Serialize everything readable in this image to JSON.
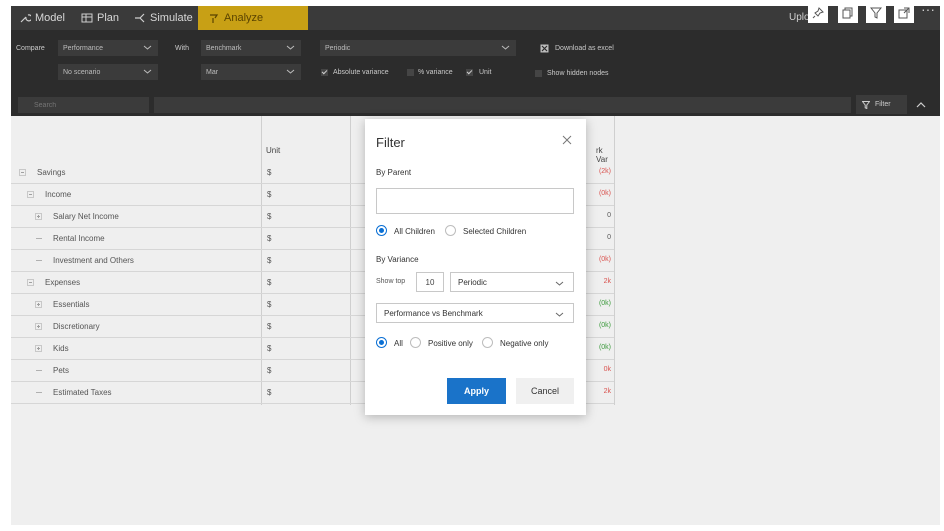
{
  "nav": {
    "tabs": [
      {
        "label": "Model",
        "icon": "wrench-icon"
      },
      {
        "label": "Plan",
        "icon": "table-icon"
      },
      {
        "label": "Simulate",
        "icon": "simulate-icon"
      },
      {
        "label": "Analyze",
        "icon": "analyze-icon"
      }
    ],
    "active_tab": "Analyze",
    "upload_label": "Uploa",
    "active_color": "#c8a015"
  },
  "controls": {
    "compare_label": "Compare",
    "compare_value": "Performance",
    "scenario_value": "No scenario",
    "with_label": "With",
    "with_value": "Benchmark",
    "month_value": "Mar",
    "period_value": "Periodic",
    "abs_variance_label": "Absolute variance",
    "abs_variance_checked": true,
    "pct_variance_label": "% variance",
    "pct_variance_checked": false,
    "unit_label": "Unit",
    "unit_checked": true,
    "download_label": "Download as excel",
    "hidden_nodes_label": "Show hidden nodes",
    "hidden_nodes_checked": false
  },
  "search": {
    "placeholder": "Search",
    "filter_label": "Filter"
  },
  "grid": {
    "unit_header": "Unit",
    "variance_header": "rk Var",
    "rows": [
      {
        "label": "Savings",
        "unit": "$",
        "value": "(2k)",
        "tone": "negative",
        "indent": 0,
        "marker": "minus"
      },
      {
        "label": "Income",
        "unit": "$",
        "value": "(0k)",
        "tone": "negative",
        "indent": 1,
        "marker": "minus"
      },
      {
        "label": "Salary Net Income",
        "unit": "$",
        "value": "0",
        "tone": "neutral",
        "indent": 2,
        "marker": "plus"
      },
      {
        "label": "Rental Income",
        "unit": "$",
        "value": "0",
        "tone": "neutral",
        "indent": 2,
        "marker": "dash"
      },
      {
        "label": "Investment and Others",
        "unit": "$",
        "value": "(0k)",
        "tone": "negative",
        "indent": 2,
        "marker": "dash"
      },
      {
        "label": "Expenses",
        "unit": "$",
        "value": "2k",
        "tone": "negative",
        "indent": 1,
        "marker": "minus"
      },
      {
        "label": "Essentials",
        "unit": "$",
        "value": "(0k)",
        "tone": "positive",
        "indent": 2,
        "marker": "plus"
      },
      {
        "label": "Discretionary",
        "unit": "$",
        "value": "(0k)",
        "tone": "positive",
        "indent": 2,
        "marker": "plus"
      },
      {
        "label": "Kids",
        "unit": "$",
        "value": "(0k)",
        "tone": "positive",
        "indent": 2,
        "marker": "plus"
      },
      {
        "label": "Pets",
        "unit": "$",
        "value": "0k",
        "tone": "negative",
        "indent": 2,
        "marker": "dash"
      },
      {
        "label": "Estimated Taxes",
        "unit": "$",
        "value": "2k",
        "tone": "negative",
        "indent": 2,
        "marker": "dash"
      }
    ],
    "colors": {
      "negative": "#d9534f",
      "positive": "#3c9a3c",
      "neutral": "#555555"
    }
  },
  "filter_dialog": {
    "title": "Filter",
    "by_parent_label": "By Parent",
    "parent_value": "",
    "all_children_label": "All Children",
    "selected_children_label": "Selected Children",
    "children_choice": "all",
    "by_variance_label": "By Variance",
    "show_top_label": "Show top",
    "top_n": "10",
    "period_option": "Periodic",
    "comparison_option": "Performance vs Benchmark",
    "all_label": "All",
    "positive_only_label": "Positive only",
    "negative_only_label": "Negative only",
    "sign_choice": "all",
    "apply_label": "Apply",
    "cancel_label": "Cancel",
    "apply_color": "#1a73c9"
  }
}
